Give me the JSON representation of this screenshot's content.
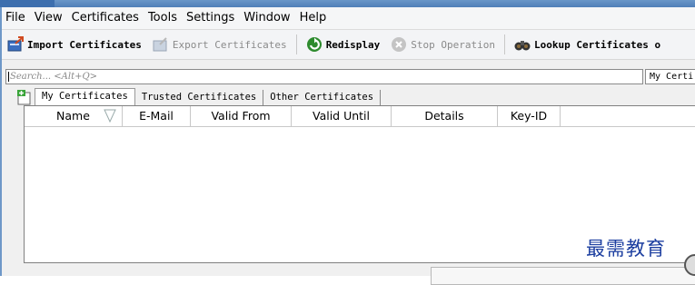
{
  "menu": [
    "File",
    "View",
    "Certificates",
    "Tools",
    "Settings",
    "Window",
    "Help"
  ],
  "toolbar": {
    "import": "Import Certificates",
    "export": "Export Certificates",
    "redisplay": "Redisplay",
    "stop": "Stop Operation",
    "lookup": "Lookup Certificates o"
  },
  "search": {
    "placeholder": "Search... <Alt+Q>"
  },
  "filter": {
    "value": "My Certi"
  },
  "tabs": [
    "My Certificates",
    "Trusted Certificates",
    "Other Certificates"
  ],
  "columns": [
    "Name",
    "E-Mail",
    "Valid From",
    "Valid Until",
    "Details",
    "Key-ID"
  ],
  "watermark": "最需教育",
  "colors": {
    "title": "#4f7fb8",
    "accent_green": "#2e8b2e",
    "watermark": "#1d3fa0"
  }
}
